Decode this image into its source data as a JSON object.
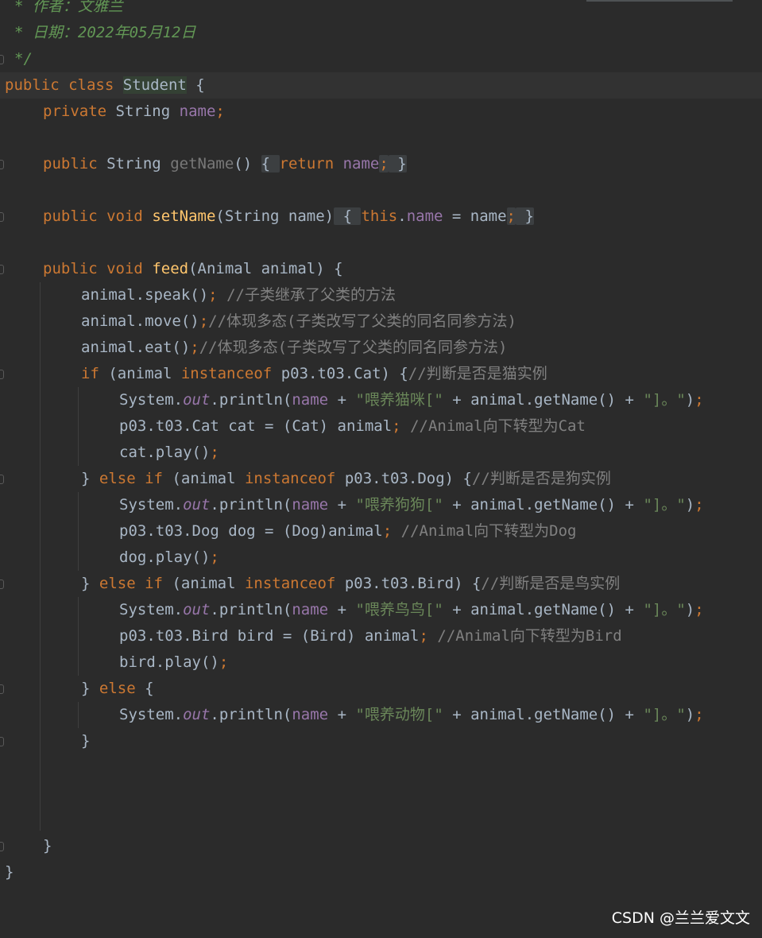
{
  "footer": {
    "watermark": "CSDN @兰兰爱文文"
  },
  "code": {
    "javadoc": {
      "author": "* 作者：文雅兰",
      "date": "* 日期：2022年05月12日",
      "end": "*/"
    },
    "class_decl": {
      "kw_public": "public",
      "kw_class": "class",
      "name": "Student",
      "brace": "{"
    },
    "field": {
      "kw": "private",
      "type": "String",
      "name": "name",
      "semi": ";"
    },
    "get_name": {
      "kw": "public",
      "type": "String",
      "name": "getName",
      "parens": "()",
      "open": "{",
      "kw_return": "return",
      "field": "name",
      "semi": ";",
      "close": "}"
    },
    "set_name": {
      "kw": "public",
      "type": "void",
      "name": "setName",
      "params": "(String name)",
      "open": "{",
      "kw_this": "this",
      "dot": ".",
      "field": "name",
      "assign": " = name",
      "semi": ";",
      "close": "}"
    },
    "feed": {
      "kw": "public",
      "type": "void",
      "name": "feed",
      "params": "(Animal animal) {"
    },
    "speak": {
      "call": "animal.speak()",
      "semi": ";",
      "comment": "//子类继承了父类的方法"
    },
    "move": {
      "call": "animal.move()",
      "semi": ";",
      "comment": "//体现多态(子类改写了父类的同名同参方法)"
    },
    "eat": {
      "call": "animal.eat()",
      "semi": ";",
      "comment": "//体现多态(子类改写了父类的同名同参方法)"
    },
    "if_cat": {
      "kw_if": "if",
      "open": "(animal ",
      "kw_instanceof": "instanceof",
      "rest": "p03.t03.Cat) {",
      "comment": "//判断是否是猫实例"
    },
    "print_cat": {
      "prefix": "System.",
      "out": "out",
      "call": ".println(",
      "field": "name",
      "plus": " + ",
      "str": "\"喂养猫咪[\"",
      "mid": " + animal.getName() + ",
      "str2": "\"]。\"",
      "end": ")",
      "semi": ";"
    },
    "cast_cat": {
      "code": "p03.t03.Cat cat = (Cat) animal",
      "semi": ";",
      "comment": "//Animal向下转型为Cat"
    },
    "play_cat": {
      "code": "cat.play()",
      "semi": ";"
    },
    "elif_dog": {
      "close": "} ",
      "kw_else": "else",
      "kw_if": "if",
      "open": "(animal ",
      "kw_instanceof": "instanceof",
      "rest": "p03.t03.Dog) {",
      "comment": "//判断是否是狗实例"
    },
    "print_dog": {
      "prefix": "System.",
      "out": "out",
      "call": ".println(",
      "field": "name",
      "plus": " + ",
      "str": "\"喂养狗狗[\"",
      "mid": " + animal.getName() + ",
      "str2": "\"]。\"",
      "end": ")",
      "semi": ";"
    },
    "cast_dog": {
      "code": "p03.t03.Dog dog = (Dog)animal",
      "semi": ";",
      "comment": "//Animal向下转型为Dog"
    },
    "play_dog": {
      "code": "dog.play()",
      "semi": ";"
    },
    "elif_bird": {
      "close": "} ",
      "kw_else": "else",
      "kw_if": "if",
      "open": "(animal ",
      "kw_instanceof": "instanceof",
      "rest": "p03.t03.Bird) {",
      "comment": "//判断是否是鸟实例"
    },
    "print_bird": {
      "prefix": "System.",
      "out": "out",
      "call": ".println(",
      "field": "name",
      "plus": " + ",
      "str": "\"喂养鸟鸟[\"",
      "mid": " + animal.getName() + ",
      "str2": "\"]。\"",
      "end": ")",
      "semi": ";"
    },
    "cast_bird": {
      "code": "p03.t03.Bird bird = (Bird) animal",
      "semi": ";",
      "comment": "//Animal向下转型为Bird"
    },
    "play_bird": {
      "code": "bird.play()",
      "semi": ";"
    },
    "else_line": {
      "close": "} ",
      "kw_else": "else",
      "open": " {"
    },
    "print_animal": {
      "prefix": "System.",
      "out": "out",
      "call": ".println(",
      "field": "name",
      "plus": " + ",
      "str": "\"喂养动物[\"",
      "mid": " + animal.getName() + ",
      "str2": "\"]。\"",
      "end": ")",
      "semi": ";"
    },
    "close_if": "}",
    "close_method": "}",
    "close_class": "}"
  }
}
